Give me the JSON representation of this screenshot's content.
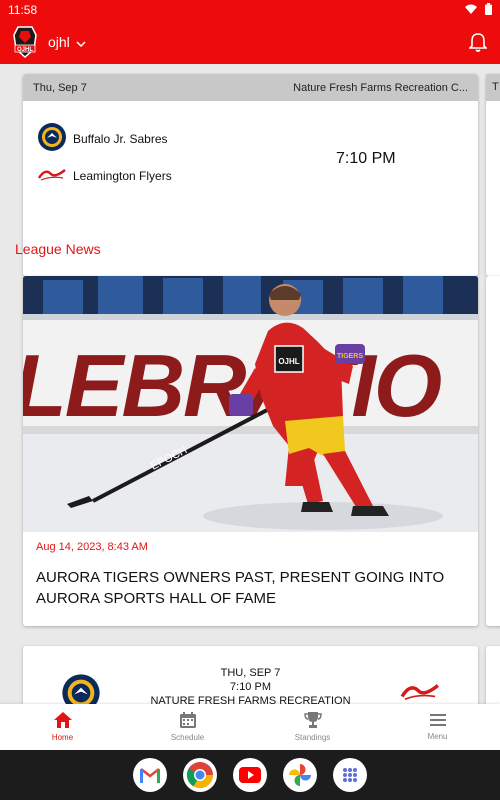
{
  "status_bar": {
    "time": "11:58"
  },
  "app_bar": {
    "league": "ojhl",
    "logo_text": "OJHL"
  },
  "games": [
    {
      "date": "Thu, Sep 7",
      "venue": "Nature Fresh Farms Recreation C...",
      "home_team": "Buffalo Jr. Sabres",
      "away_team": "Leamington Flyers",
      "time": "7:10 PM"
    }
  ],
  "peek_card": {
    "header_initial": "T"
  },
  "league_news": {
    "title": "League News",
    "articles": [
      {
        "date": "Aug 14, 2023, 8:43 AM",
        "headline": "AURORA TIGERS OWNERS PAST, PRESENT GOING INTO AURORA SPORTS HALL OF FAME",
        "banner_text": "LEBRATIO",
        "jersey_text": "OJHL",
        "glove_text": "TIGERS",
        "stick_text": "EPOCH"
      }
    ]
  },
  "game_card_2": {
    "day": "THU, SEP 7",
    "time": "7:10 PM",
    "venue": "NATURE FRESH FARMS RECREATION"
  },
  "bottom_nav": [
    {
      "label": "Home",
      "icon": "home-icon",
      "active": true
    },
    {
      "label": "Schedule",
      "icon": "calendar-icon",
      "active": false
    },
    {
      "label": "Standings",
      "icon": "trophy-icon",
      "active": false
    },
    {
      "label": "Menu",
      "icon": "menu-icon",
      "active": false
    }
  ],
  "colors": {
    "brand_red": "#ee0b0b",
    "accent_red": "#e11515"
  }
}
